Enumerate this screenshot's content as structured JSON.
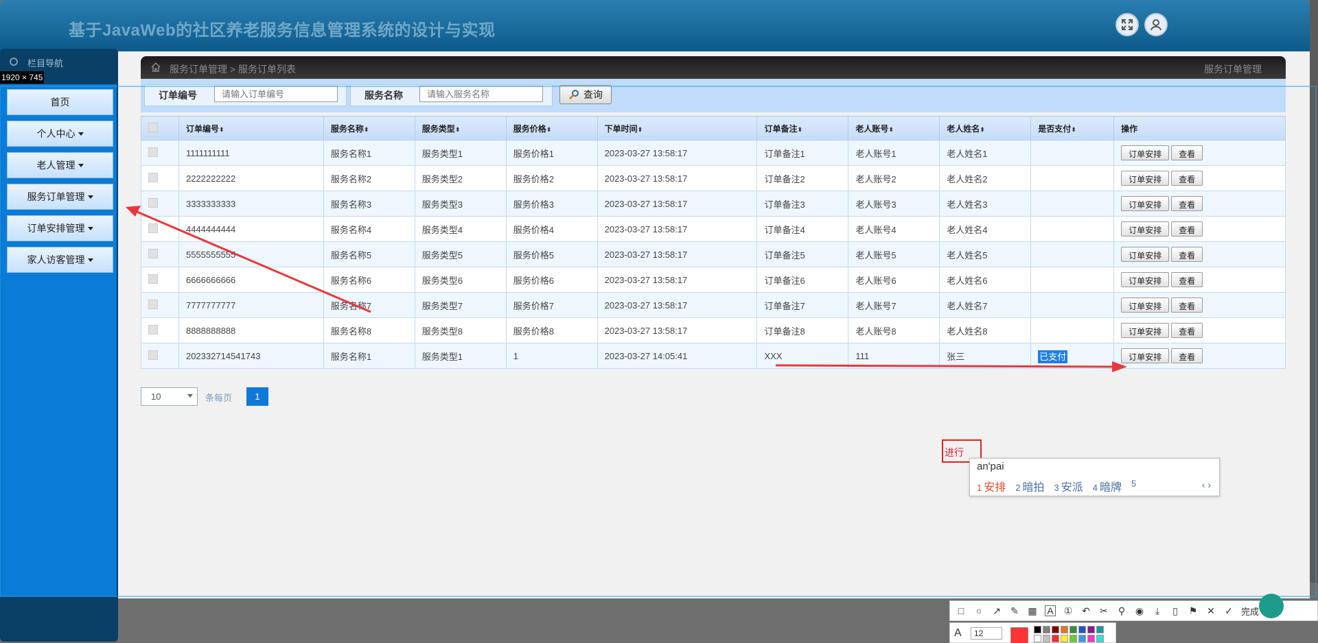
{
  "header": {
    "title": "基于JavaWeb的社区养老服务信息管理系统的设计与实现",
    "fullscreen_icon": "fullscreen-icon",
    "user_icon": "user-icon"
  },
  "sidebar": {
    "heading": "栏目导航",
    "items": [
      {
        "label": "首页",
        "has_caret": false
      },
      {
        "label": "个人中心",
        "has_caret": true
      },
      {
        "label": "老人管理",
        "has_caret": true
      },
      {
        "label": "服务订单管理",
        "has_caret": true
      },
      {
        "label": "订单安排管理",
        "has_caret": true
      },
      {
        "label": "家人访客管理",
        "has_caret": true
      }
    ]
  },
  "size_label": "1920 × 745",
  "breadcrumb": {
    "path": "服务订单管理 > 服务订单列表",
    "right": "服务订单管理"
  },
  "search": {
    "order_no_label": "订单编号",
    "order_no_placeholder": "请输入订单编号",
    "service_name_label": "服务名称",
    "service_name_placeholder": "请输入服务名称",
    "query_button": "查询"
  },
  "table": {
    "columns": [
      "订单编号",
      "服务名称",
      "服务类型",
      "服务价格",
      "下单时间",
      "订单备注",
      "老人账号",
      "老人姓名",
      "是否支付",
      "操作"
    ],
    "sort_glyph": "⬍",
    "rows": [
      {
        "order_no": "1111111111",
        "service_name": "服务名称1",
        "service_type": "服务类型1",
        "price": "服务价格1",
        "time": "2023-03-27 13:58:17",
        "remark": "订单备注1",
        "account": "老人账号1",
        "name": "老人姓名1",
        "paid": ""
      },
      {
        "order_no": "2222222222",
        "service_name": "服务名称2",
        "service_type": "服务类型2",
        "price": "服务价格2",
        "time": "2023-03-27 13:58:17",
        "remark": "订单备注2",
        "account": "老人账号2",
        "name": "老人姓名2",
        "paid": ""
      },
      {
        "order_no": "3333333333",
        "service_name": "服务名称3",
        "service_type": "服务类型3",
        "price": "服务价格3",
        "time": "2023-03-27 13:58:17",
        "remark": "订单备注3",
        "account": "老人账号3",
        "name": "老人姓名3",
        "paid": ""
      },
      {
        "order_no": "4444444444",
        "service_name": "服务名称4",
        "service_type": "服务类型4",
        "price": "服务价格4",
        "time": "2023-03-27 13:58:17",
        "remark": "订单备注4",
        "account": "老人账号4",
        "name": "老人姓名4",
        "paid": ""
      },
      {
        "order_no": "5555555555",
        "service_name": "服务名称5",
        "service_type": "服务类型5",
        "price": "服务价格5",
        "time": "2023-03-27 13:58:17",
        "remark": "订单备注5",
        "account": "老人账号5",
        "name": "老人姓名5",
        "paid": ""
      },
      {
        "order_no": "6666666666",
        "service_name": "服务名称6",
        "service_type": "服务类型6",
        "price": "服务价格6",
        "time": "2023-03-27 13:58:17",
        "remark": "订单备注6",
        "account": "老人账号6",
        "name": "老人姓名6",
        "paid": ""
      },
      {
        "order_no": "7777777777",
        "service_name": "服务名称7",
        "service_type": "服务类型7",
        "price": "服务价格7",
        "time": "2023-03-27 13:58:17",
        "remark": "订单备注7",
        "account": "老人账号7",
        "name": "老人姓名7",
        "paid": ""
      },
      {
        "order_no": "8888888888",
        "service_name": "服务名称8",
        "service_type": "服务类型8",
        "price": "服务价格8",
        "time": "2023-03-27 13:58:17",
        "remark": "订单备注8",
        "account": "老人账号8",
        "name": "老人姓名8",
        "paid": ""
      },
      {
        "order_no": "202332714541743",
        "service_name": "服务名称1",
        "service_type": "服务类型1",
        "price": "1",
        "time": "2023-03-27 14:05:41",
        "remark": "XXX",
        "account": "111",
        "name": "张三",
        "paid": "已支付"
      }
    ],
    "actions": [
      "订单安排",
      "查看"
    ]
  },
  "pagination": {
    "page_size": "10",
    "per_page_label": "条每页",
    "current_page": "1"
  },
  "annotation": {
    "typed_text": "进行",
    "ime_composition": "an'pai",
    "ime_candidates": [
      {
        "num": "1",
        "text": "安排"
      },
      {
        "num": "2",
        "text": "暗拍"
      },
      {
        "num": "3",
        "text": "安派"
      },
      {
        "num": "4",
        "text": "暗牌"
      },
      {
        "num": "5",
        "text": ""
      }
    ],
    "ime_nav": "‹ ›",
    "arrow_color": "#e8383d"
  },
  "screenshot_toolbar": {
    "done_label": "完成",
    "font_size": "12",
    "tools": [
      "rectangle-icon",
      "ellipse-icon",
      "arrow-icon",
      "pen-icon",
      "mosaic-icon",
      "text-icon",
      "number-icon",
      "undo-icon",
      "cut-icon",
      "pin-icon",
      "record-icon",
      "download-icon",
      "save-icon",
      "bookmark-icon",
      "close-icon",
      "check-icon"
    ],
    "palette": [
      "#000000",
      "#808080",
      "#800000",
      "#e07820",
      "#3a8a3a",
      "#2255cc",
      "#8a1a8a",
      "#1a9a9a",
      "#ffffff",
      "#c0c0c0",
      "#ff2a2a",
      "#ffee33",
      "#66cc33",
      "#3399ff",
      "#ff33cc",
      "#33dddd"
    ]
  }
}
